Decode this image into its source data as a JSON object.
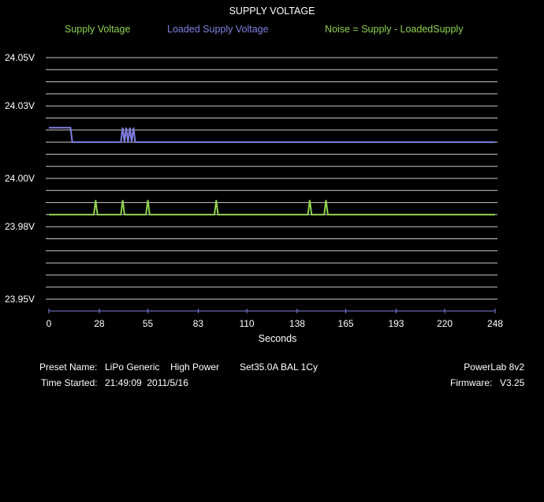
{
  "colors": {
    "background": "#000000",
    "grid": "#c8c8c8",
    "axis": "#ffffff",
    "tick": "#7f7fe0"
  },
  "chart_data": {
    "type": "line",
    "title": "SUPPLY VOLTAGE",
    "xlabel": "Seconds",
    "ylabel": "",
    "xlim": [
      0,
      248
    ],
    "ylim": [
      23.95,
      24.05
    ],
    "grid": true,
    "legend_placement": "top",
    "x_ticks": [
      0,
      28,
      55,
      83,
      110,
      138,
      165,
      193,
      220,
      248
    ],
    "y_tick_labels": [
      {
        "value": 24.05,
        "label": "24.05V"
      },
      {
        "value": 24.03,
        "label": "24.03V"
      },
      {
        "value": 24.0,
        "label": "24.00V"
      },
      {
        "value": 23.98,
        "label": "23.98V"
      },
      {
        "value": 23.95,
        "label": "23.95V"
      }
    ],
    "series": [
      {
        "name": "Supply Voltage",
        "color": "#8fd14f",
        "x": [],
        "y": []
      },
      {
        "name": "Loaded Supply Voltage",
        "color": "#7f7fe0",
        "x": [
          0,
          12,
          13,
          40,
          41,
          42,
          43,
          44,
          45,
          46,
          47,
          48,
          49,
          248
        ],
        "y": [
          24.021,
          24.021,
          24.015,
          24.015,
          24.021,
          24.015,
          24.021,
          24.015,
          24.021,
          24.015,
          24.021,
          24.015,
          24.015,
          24.015
        ]
      },
      {
        "name": "Noise = Supply - LoadedSupply",
        "color": "#8fd14f",
        "x": [
          0,
          25,
          26,
          27,
          40,
          41,
          42,
          54,
          55,
          56,
          92,
          93,
          94,
          144,
          145,
          146,
          153,
          154,
          155,
          248
        ],
        "y": [
          23.985,
          23.985,
          23.991,
          23.985,
          23.985,
          23.991,
          23.985,
          23.985,
          23.991,
          23.985,
          23.985,
          23.991,
          23.985,
          23.985,
          23.991,
          23.985,
          23.985,
          23.991,
          23.985,
          23.985
        ]
      }
    ]
  },
  "footer": {
    "preset_label": "Preset Name:",
    "preset_value": "LiPo Generic",
    "power_mode": "High Power",
    "set_info": "Set35.0A BAL 1Cy",
    "time_label": "Time Started:",
    "time_value": "21:49:09  2011/5/16",
    "device": "PowerLab 8v2",
    "firmware_label": "Firmware:",
    "firmware_value": "V3.25"
  }
}
